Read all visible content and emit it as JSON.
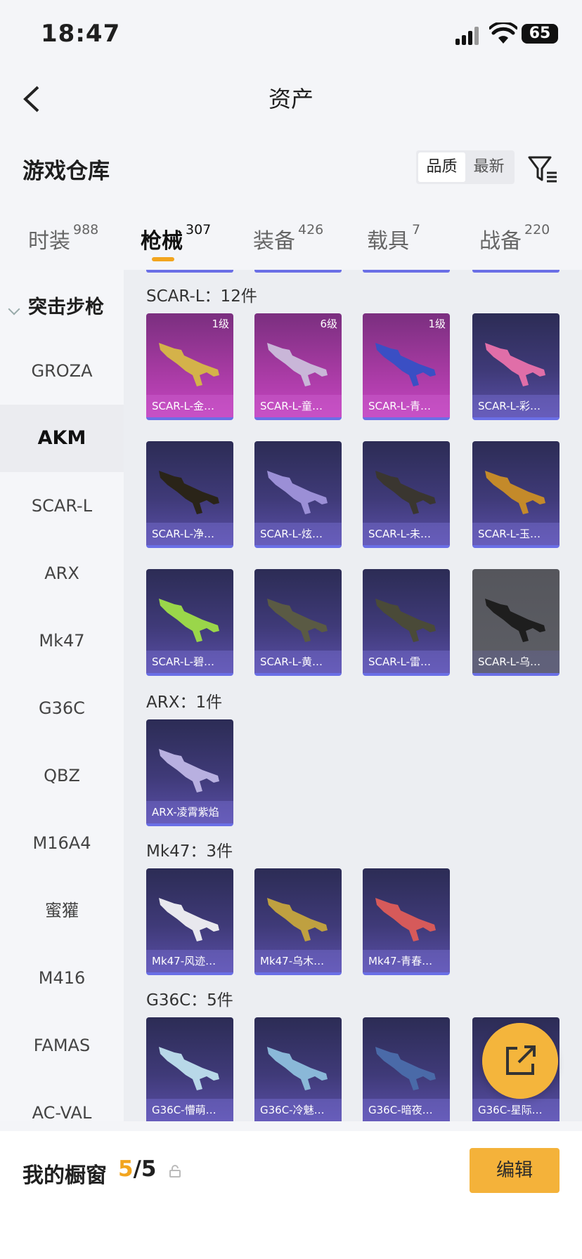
{
  "status_bar": {
    "time": "18:47",
    "battery": "65"
  },
  "nav": {
    "title": "资产"
  },
  "warehouse": {
    "title": "游戏仓库",
    "sort": [
      "品质",
      "最新"
    ]
  },
  "tabs": [
    {
      "label": "时装",
      "count": "988"
    },
    {
      "label": "枪械",
      "count": "307"
    },
    {
      "label": "装备",
      "count": "426"
    },
    {
      "label": "载具",
      "count": "7"
    },
    {
      "label": "战备",
      "count": "220"
    }
  ],
  "sidebar": {
    "group": "突击步枪",
    "items": [
      "GROZA",
      "AKM",
      "SCAR-L",
      "ARX",
      "Mk47",
      "G36C",
      "QBZ",
      "M16A4",
      "蜜獾",
      "M416",
      "FAMAS",
      "AC-VAL"
    ]
  },
  "sections": [
    {
      "title": "SCAR-L：12件",
      "items": [
        {
          "name": "SCAR-L-金…",
          "level": "1级"
        },
        {
          "name": "SCAR-L-童…",
          "level": "6级"
        },
        {
          "name": "SCAR-L-青…",
          "level": "1级"
        },
        {
          "name": "SCAR-L-彩…",
          "level": ""
        },
        {
          "name": "SCAR-L-净…",
          "level": ""
        },
        {
          "name": "SCAR-L-炫…",
          "level": ""
        },
        {
          "name": "SCAR-L-未…",
          "level": ""
        },
        {
          "name": "SCAR-L-玉…",
          "level": ""
        },
        {
          "name": "SCAR-L-碧…",
          "level": ""
        },
        {
          "name": "SCAR-L-黄…",
          "level": ""
        },
        {
          "name": "SCAR-L-雷…",
          "level": ""
        },
        {
          "name": "SCAR-L-乌…",
          "level": ""
        }
      ]
    },
    {
      "title": "ARX：1件",
      "items": [
        {
          "name": "ARX-凌霄紫焰",
          "level": ""
        }
      ]
    },
    {
      "title": "Mk47：3件",
      "items": [
        {
          "name": "Mk47-风迹…",
          "level": ""
        },
        {
          "name": "Mk47-乌木…",
          "level": ""
        },
        {
          "name": "Mk47-青春…",
          "level": ""
        }
      ]
    },
    {
      "title": "G36C：5件",
      "items": [
        {
          "name": "G36C-懵萌…",
          "level": ""
        },
        {
          "name": "G36C-冷魅…",
          "level": ""
        },
        {
          "name": "G36C-暗夜…",
          "level": ""
        },
        {
          "name": "G36C-星际…",
          "level": ""
        }
      ]
    }
  ],
  "bottom": {
    "label": "我的橱窗",
    "current": "5",
    "total": "/5",
    "edit": "编辑"
  },
  "colors": {
    "accent": "#f2a51e",
    "card_pink": "#b03fb0",
    "card_purple": "#3f3a78",
    "card_grey": "#5a5b61"
  }
}
